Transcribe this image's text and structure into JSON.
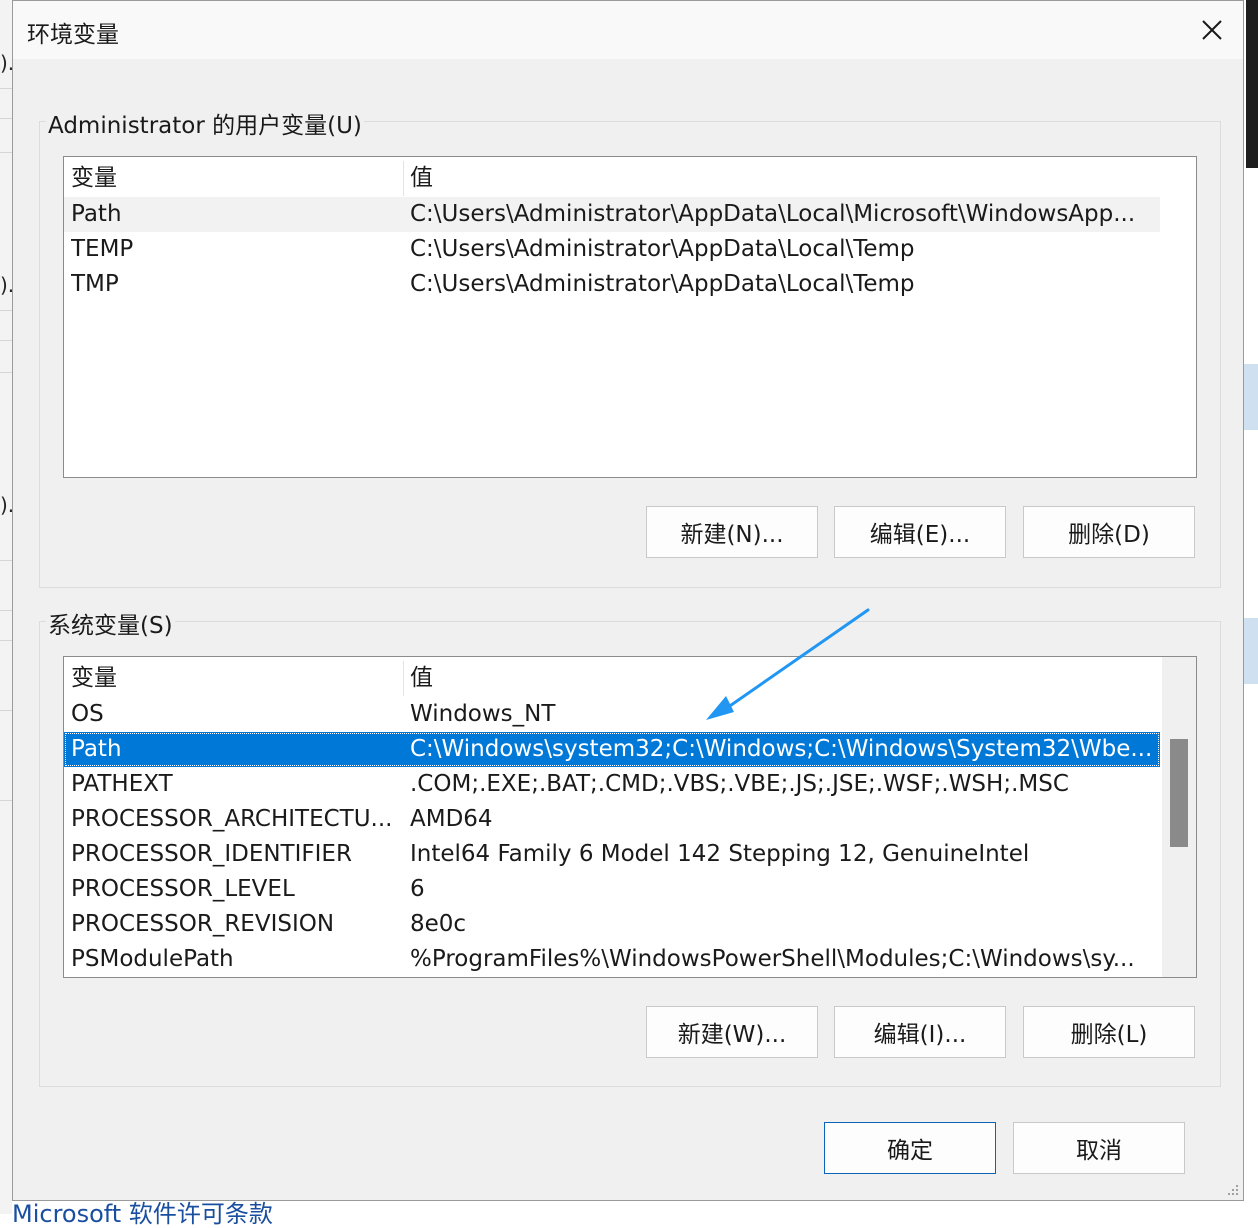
{
  "dialog": {
    "title": "环境变量",
    "close_label": "×"
  },
  "user_section": {
    "label": "Administrator 的用户变量(U)",
    "columns": [
      "变量",
      "值"
    ],
    "rows": [
      {
        "name": "Path",
        "value": "C:\\Users\\Administrator\\AppData\\Local\\Microsoft\\WindowsApp..."
      },
      {
        "name": "TEMP",
        "value": "C:\\Users\\Administrator\\AppData\\Local\\Temp"
      },
      {
        "name": "TMP",
        "value": "C:\\Users\\Administrator\\AppData\\Local\\Temp"
      }
    ],
    "buttons": {
      "new": "新建(N)...",
      "edit": "编辑(E)...",
      "delete": "删除(D)"
    }
  },
  "system_section": {
    "label": "系统变量(S)",
    "columns": [
      "变量",
      "值"
    ],
    "selected_row": "Path",
    "rows": [
      {
        "name": "OS",
        "value": "Windows_NT"
      },
      {
        "name": "Path",
        "value": "C:\\Windows\\system32;C:\\Windows;C:\\Windows\\System32\\Wbe..."
      },
      {
        "name": "PATHEXT",
        "value": ".COM;.EXE;.BAT;.CMD;.VBS;.VBE;.JS;.JSE;.WSF;.WSH;.MSC"
      },
      {
        "name": "PROCESSOR_ARCHITECTU...",
        "value": "AMD64"
      },
      {
        "name": "PROCESSOR_IDENTIFIER",
        "value": "Intel64 Family 6 Model 142 Stepping 12, GenuineIntel"
      },
      {
        "name": "PROCESSOR_LEVEL",
        "value": "6"
      },
      {
        "name": "PROCESSOR_REVISION",
        "value": "8e0c"
      },
      {
        "name": "PSModulePath",
        "value": "%ProgramFiles%\\WindowsPowerShell\\Modules;C:\\Windows\\sy..."
      }
    ],
    "buttons": {
      "new": "新建(W)...",
      "edit": "编辑(I)...",
      "delete": "删除(L)"
    }
  },
  "footer": {
    "ok": "确定",
    "cancel": "取消"
  },
  "background": {
    "bottom_text": "Microsoft 软件许可条款"
  },
  "colors": {
    "selection": "#0078d7",
    "annotation_arrow": "#2196f3",
    "dialog_bg": "#f0f0f0"
  }
}
